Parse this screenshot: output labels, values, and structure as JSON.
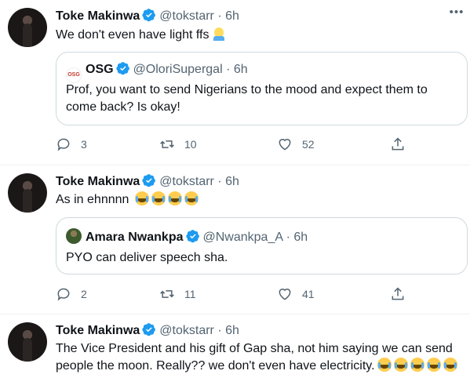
{
  "colors": {
    "verified": "#1d9bf0",
    "muted": "#536471",
    "border": "#cfd9de",
    "divider": "#eff3f4"
  },
  "tweets": [
    {
      "name": "Toke Makinwa",
      "handle": "@tokstarr",
      "dot": "·",
      "time": "6h",
      "text": "We don't even have light ffs",
      "emoji": "facepalm-emoji",
      "quote": {
        "name": "OSG",
        "handle": "@OloriSupergal",
        "dot": "·",
        "time": "6h",
        "text": "Prof, you want to send Nigerians to the mood and expect them to come back? Is okay!"
      },
      "replies": "3",
      "retweets": "10",
      "likes": "52"
    },
    {
      "name": "Toke Makinwa",
      "handle": "@tokstarr",
      "dot": "·",
      "time": "6h",
      "text": "As in ehnnnn",
      "emoji": "tears-of-joy-emoji",
      "emoji_count": 4,
      "quote": {
        "name": "Amara Nwankpa",
        "handle": "@Nwankpa_A",
        "dot": "·",
        "time": "6h",
        "text": "PYO can deliver speech sha."
      },
      "replies": "2",
      "retweets": "11",
      "likes": "41"
    },
    {
      "name": "Toke Makinwa",
      "handle": "@tokstarr",
      "dot": "·",
      "time": "6h",
      "text_line1": "The Vice President and his gift of Gap sha, not him saying we can send",
      "text_line2": "people the moon. Really?? we don't even have electricity.",
      "emoji": "tears-of-joy-emoji",
      "emoji_count": 5
    }
  ]
}
